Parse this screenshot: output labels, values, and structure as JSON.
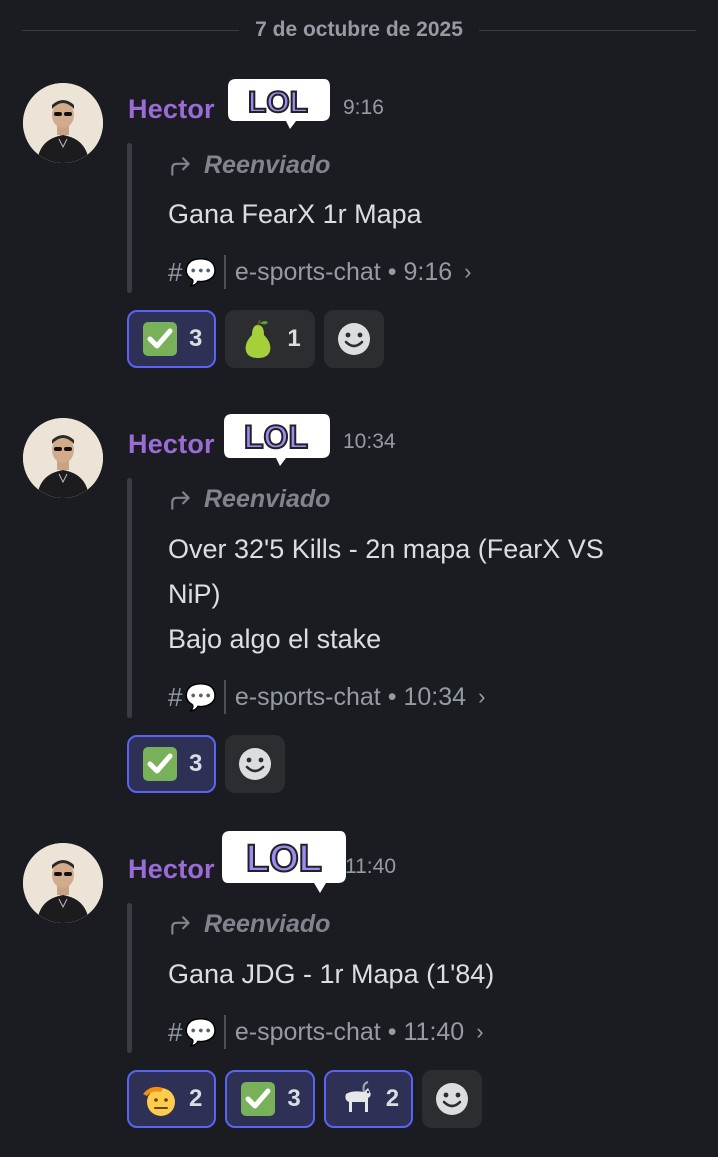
{
  "date_divider": "7 de octubre de 2025",
  "messages": [
    {
      "author": "Hector",
      "author_tail": "o",
      "time": "9:16",
      "forwarded_label": "Reenviado",
      "lines": [
        "Gana FearX 1r Mapa"
      ],
      "source_hash": "#",
      "source_channel": "e-sports-chat",
      "source_time": "9:16",
      "reactions": [
        {
          "emoji": "check-mark-icon",
          "count": "3",
          "active": true
        },
        {
          "emoji": "pear-icon",
          "count": "1",
          "active": false
        }
      ]
    },
    {
      "author": "Hector",
      "time": "10:34",
      "forwarded_label": "Reenviado",
      "lines": [
        "Over 32'5 Kills - 2n mapa (FearX VS",
        "NiP)",
        "Bajo algo el stake"
      ],
      "source_hash": "#",
      "source_channel": "e-sports-chat",
      "source_time": "10:34",
      "reactions": [
        {
          "emoji": "check-mark-icon",
          "count": "3",
          "active": true
        }
      ]
    },
    {
      "author": "Hector",
      "time": "11:40",
      "forwarded_label": "Reenviado",
      "lines": [
        "Gana JDG - 1r Mapa (1'84)"
      ],
      "source_hash": "#",
      "source_channel": "e-sports-chat",
      "source_time": "11:40",
      "reactions": [
        {
          "emoji": "saluting-face-icon",
          "count": "2",
          "active": true
        },
        {
          "emoji": "check-mark-icon",
          "count": "3",
          "active": true
        },
        {
          "emoji": "goat-icon",
          "count": "2",
          "active": true
        }
      ]
    }
  ],
  "badge_text": "LOL",
  "colors": {
    "background": "#1b1c21",
    "username": "#9b6bd6",
    "active_reaction_border": "#5865f2",
    "active_reaction_bg": "#2e3055",
    "reaction_bg": "#2b2d31",
    "check_green": "#78b159"
  }
}
